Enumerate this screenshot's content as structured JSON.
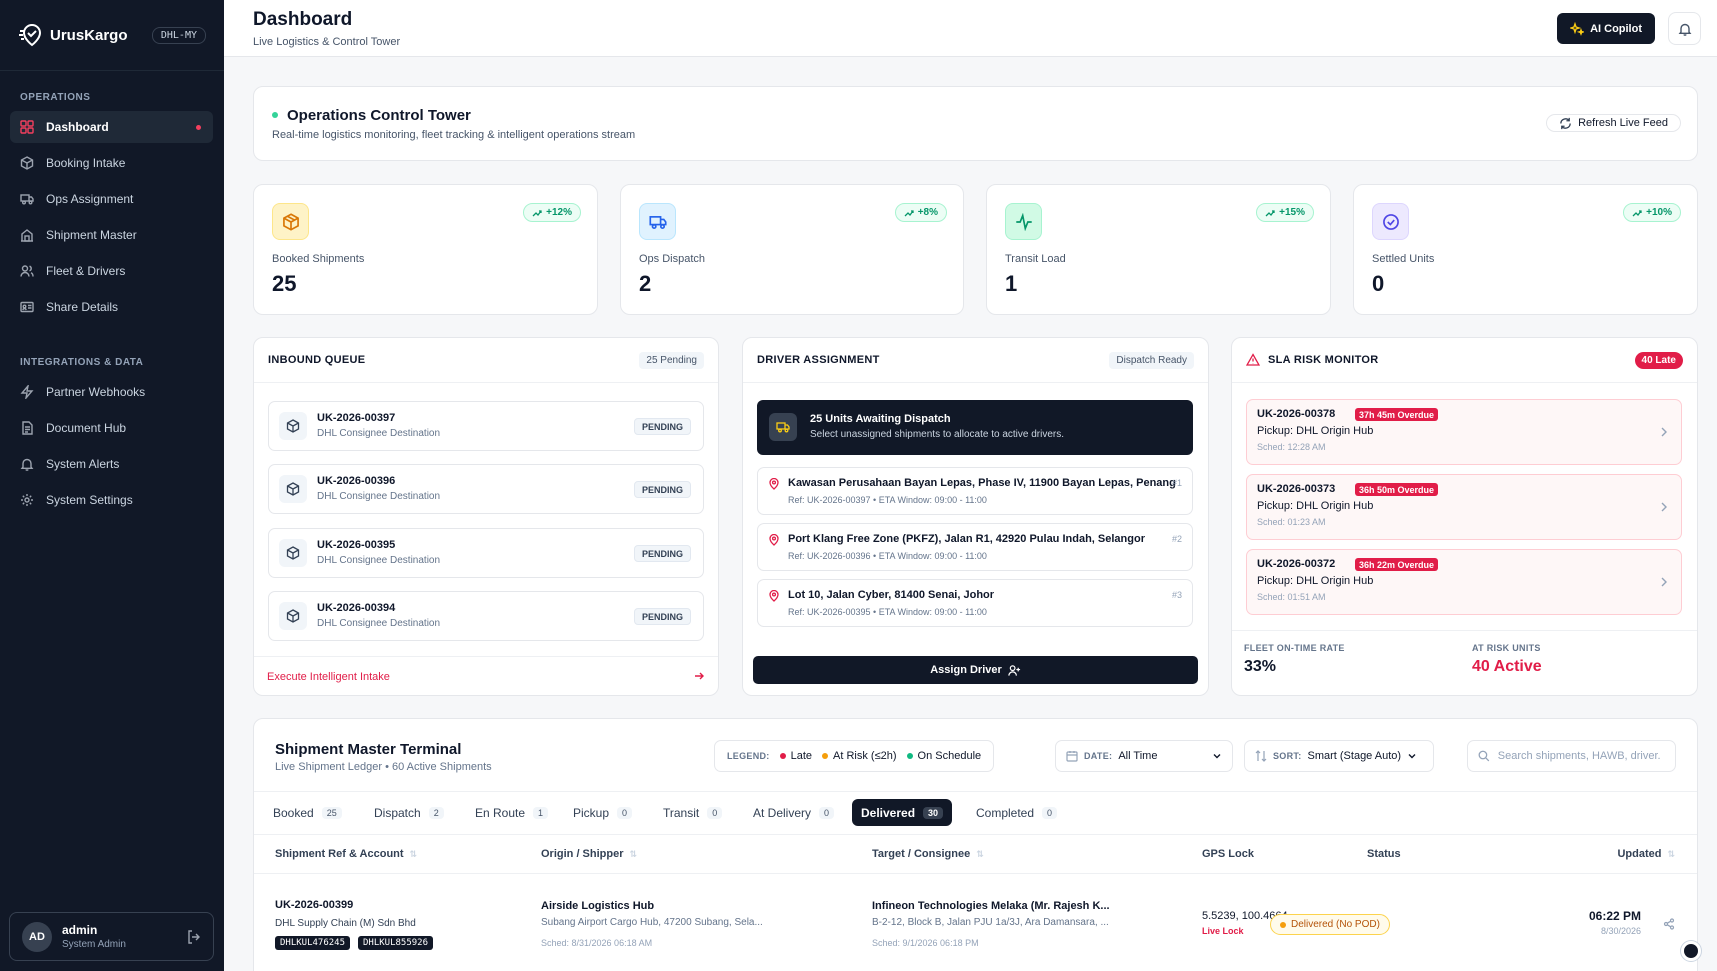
{
  "brand": {
    "name": "UrusKargo",
    "region": "DHL-MY"
  },
  "sidebar": {
    "section_ops": "OPERATIONS",
    "ops_items": [
      {
        "label": "Dashboard",
        "icon": "grid-icon"
      },
      {
        "label": "Booking Intake",
        "icon": "box-icon"
      },
      {
        "label": "Ops Assignment",
        "icon": "truck-icon"
      },
      {
        "label": "Shipment Master",
        "icon": "building-icon"
      },
      {
        "label": "Fleet & Drivers",
        "icon": "users-icon"
      },
      {
        "label": "Share Details",
        "icon": "id-card-icon"
      }
    ],
    "section_int": "INTEGRATIONS & DATA",
    "int_items": [
      {
        "label": "Partner Webhooks",
        "icon": "zap-icon"
      },
      {
        "label": "Document Hub",
        "icon": "document-icon"
      },
      {
        "label": "System Alerts",
        "icon": "bell-icon"
      },
      {
        "label": "System Settings",
        "icon": "gear-icon"
      }
    ]
  },
  "user": {
    "initials": "AD",
    "name": "admin",
    "role": "System Admin"
  },
  "header": {
    "title": "Dashboard",
    "subtitle": "Live Logistics & Control Tower",
    "copilot": "AI Copilot"
  },
  "octower": {
    "title": "Operations Control Tower",
    "subtitle": "Real-time logistics monitoring, fleet tracking & intelligent operations stream",
    "refresh": "Refresh Live Feed"
  },
  "kpis": [
    {
      "label": "Booked Shipments",
      "value": "25",
      "trend": "+12%",
      "icon": "package-icon",
      "bg": "#fef3c7",
      "fg": "#d97706"
    },
    {
      "label": "Ops Dispatch",
      "value": "2",
      "trend": "+8%",
      "icon": "truck-icon",
      "bg": "#e0f2fe",
      "fg": "#2563eb"
    },
    {
      "label": "Transit Load",
      "value": "1",
      "trend": "+15%",
      "icon": "activity-icon",
      "bg": "#d1fae5",
      "fg": "#059669"
    },
    {
      "label": "Settled Units",
      "value": "0",
      "trend": "+10%",
      "icon": "check-circle-icon",
      "bg": "#ede9fe",
      "fg": "#4f46e5"
    }
  ],
  "inbound": {
    "title": "INBOUND QUEUE",
    "badge": "25 Pending",
    "items": [
      {
        "id": "UK-2026-00397",
        "dest": "DHL Consignee Destination",
        "status": "PENDING"
      },
      {
        "id": "UK-2026-00396",
        "dest": "DHL Consignee Destination",
        "status": "PENDING"
      },
      {
        "id": "UK-2026-00395",
        "dest": "DHL Consignee Destination",
        "status": "PENDING"
      },
      {
        "id": "UK-2026-00394",
        "dest": "DHL Consignee Destination",
        "status": "PENDING"
      }
    ],
    "action": "Execute Intelligent Intake"
  },
  "driver": {
    "title": "DRIVER ASSIGNMENT",
    "badge": "Dispatch Ready",
    "await_title": "25 Units Awaiting Dispatch",
    "await_sub": "Select unassigned shipments to allocate to active drivers.",
    "addresses": [
      {
        "addr": "Kawasan Perusahaan Bayan Lepas, Phase IV, 11900 Bayan Lepas, Penang",
        "ref": "Ref: UK-2026-00397 • ETA Window: 09:00 - 11:00",
        "num": "#1"
      },
      {
        "addr": "Port Klang Free Zone (PKFZ), Jalan R1, 42920 Pulau Indah, Selangor",
        "ref": "Ref: UK-2026-00396 • ETA Window: 09:00 - 11:00",
        "num": "#2"
      },
      {
        "addr": "Lot 10, Jalan Cyber, 81400 Senai, Johor",
        "ref": "Ref: UK-2026-00395 • ETA Window: 09:00 - 11:00",
        "num": "#3"
      }
    ],
    "assign": "Assign Driver"
  },
  "sla": {
    "title": "SLA RISK MONITOR",
    "badge": "40 Late",
    "items": [
      {
        "id": "UK-2026-00378",
        "overdue": "37h 45m Overdue",
        "pickup": "Pickup: DHL Origin Hub",
        "sched": "Sched: 12:28 AM"
      },
      {
        "id": "UK-2026-00373",
        "overdue": "36h 50m Overdue",
        "pickup": "Pickup: DHL Origin Hub",
        "sched": "Sched: 01:23 AM"
      },
      {
        "id": "UK-2026-00372",
        "overdue": "36h 22m Overdue",
        "pickup": "Pickup: DHL Origin Hub",
        "sched": "Sched: 01:51 AM"
      }
    ],
    "ontime_label": "FLEET ON-TIME RATE",
    "ontime_value": "33%",
    "risk_label": "AT RISK UNITS",
    "risk_value": "40 Active"
  },
  "terminal": {
    "title": "Shipment Master Terminal",
    "subtitle": "Live Shipment Ledger • 60 Active Shipments",
    "legend_label": "LEGEND:",
    "legend": [
      {
        "label": "Late",
        "color": "#e11d48"
      },
      {
        "label": "At Risk (≤2h)",
        "color": "#f59e0b"
      },
      {
        "label": "On Schedule",
        "color": "#10b981"
      }
    ],
    "date_label": "DATE:",
    "date_value": "All Time",
    "sort_label": "SORT:",
    "sort_value": "Smart (Stage Auto)",
    "search_placeholder": "Search shipments, HAWB, driver.",
    "tabs": [
      {
        "label": "Booked",
        "count": "25"
      },
      {
        "label": "Dispatch",
        "count": "2"
      },
      {
        "label": "En Route",
        "count": "1"
      },
      {
        "label": "Pickup",
        "count": "0"
      },
      {
        "label": "Transit",
        "count": "0"
      },
      {
        "label": "At Delivery",
        "count": "0"
      },
      {
        "label": "Delivered",
        "count": "30"
      },
      {
        "label": "Completed",
        "count": "0"
      }
    ],
    "columns": [
      "Shipment Ref & Account",
      "Origin / Shipper",
      "Target / Consignee",
      "GPS Lock",
      "Status",
      "Updated"
    ],
    "row": {
      "ref": "UK-2026-00399",
      "account": "DHL Supply Chain (M) Sdn Bhd",
      "hawb1": "DHLKUL476245",
      "hawb2": "DHLKUL855926",
      "origin": "Airside Logistics Hub",
      "origin_addr": "Subang Airport Cargo Hub, 47200 Subang, Sela...",
      "origin_sched": "Sched: 8/31/2026 06:18 AM",
      "target": "Infineon Technologies Melaka (Mr. Rajesh K...",
      "target_addr": "B-2-12, Block B, Jalan PJU 1a/3J, Ara Damansara, ...",
      "target_sched": "Sched: 9/1/2026 06:18 PM",
      "gps": "5.5239, 100.4664",
      "gps_lock": "Live Lock",
      "status": "Delivered (No POD)",
      "time": "06:22 PM",
      "date": "8/30/2026"
    }
  }
}
